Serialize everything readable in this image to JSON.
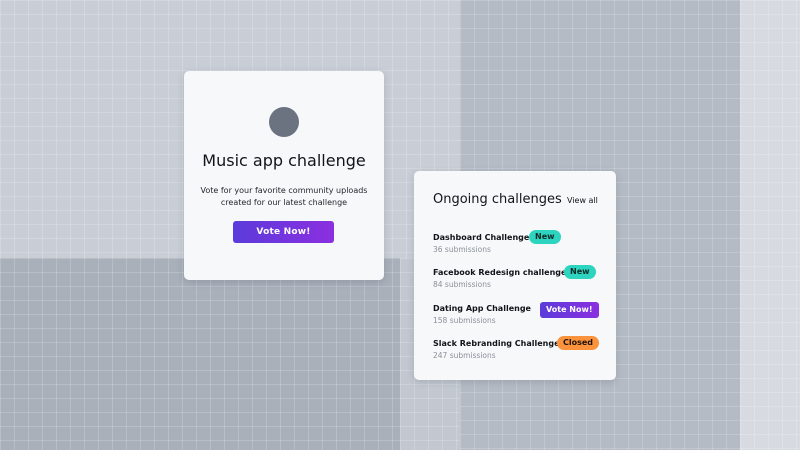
{
  "hero": {
    "avatar_icon": "user-avatar",
    "title": "Music app challenge",
    "subtitle_line1": "Vote for your favorite community uploads",
    "subtitle_line2": "created for our latest challenge",
    "button_label": "Vote Now!"
  },
  "challenges": {
    "heading": "Ongoing challenges",
    "view_all": "View all",
    "items": [
      {
        "name": "Dashboard Challenge",
        "submissions": "36 submissions",
        "status": "New"
      },
      {
        "name": "Facebook Redesign challenge",
        "submissions": "84 submissions",
        "status": "New"
      },
      {
        "name": "Dating App Challenge",
        "submissions": "158 submissions",
        "status": "Vote Now!"
      },
      {
        "name": "Slack Rebranding Challenge",
        "submissions": "247 submissions",
        "status": "Closed"
      }
    ]
  },
  "colors": {
    "accent_gradient_start": "#5b3bdb",
    "accent_gradient_end": "#8b2fe0",
    "badge_new": "#2dd4bf",
    "badge_closed": "#fb923c",
    "avatar": "#6b7280"
  }
}
